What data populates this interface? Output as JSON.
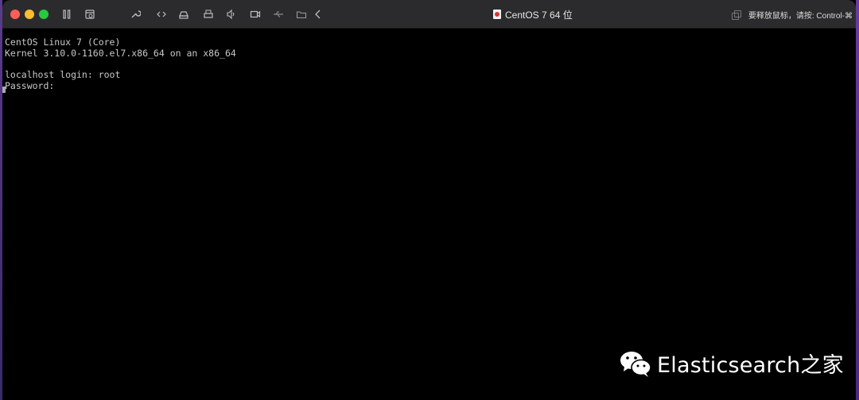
{
  "window": {
    "title": "CentOS 7 64 位",
    "release_hint": "要释放鼠标，请按: Control-⌘"
  },
  "toolbar": {
    "icons": [
      "pause-icon",
      "snapshot-icon",
      "wrench-icon",
      "code-icon",
      "drive-icon",
      "printer-icon",
      "speaker-icon",
      "camera-icon",
      "usb-icon",
      "shared-folder-icon",
      "chevron-left-icon"
    ]
  },
  "console": {
    "lines": [
      "CentOS Linux 7 (Core)",
      "Kernel 3.10.0-1160.el7.x86_64 on an x86_64",
      "",
      "localhost login: root",
      "Password:"
    ]
  },
  "watermark": {
    "text": "Elasticsearch之家"
  }
}
